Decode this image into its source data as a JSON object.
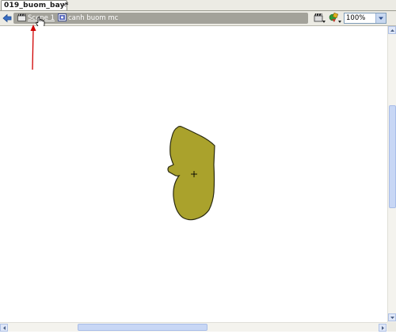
{
  "document_tab": {
    "title": "019_buom_bay*",
    "close_glyph": "×"
  },
  "edit_bar": {
    "back_icon": "back-arrow-icon",
    "breadcrumbs": [
      {
        "label": "Scene 1",
        "icon": "clapperboard-icon"
      },
      {
        "label": "canh buom mc",
        "icon": "movieclip-symbol-icon"
      }
    ],
    "edit_scene_icon": "clapperboard-dropdown-icon",
    "edit_symbol_icon": "symbol-dropdown-icon",
    "zoom": {
      "value": "100%",
      "icon": "dropdown-arrow-icon"
    }
  },
  "stage": {
    "shape_fill": "#aaa22c",
    "shape_stroke": "#2a2a10",
    "registration_mark": "crosshair-icon"
  },
  "annotation": {
    "color": "#d00000"
  }
}
